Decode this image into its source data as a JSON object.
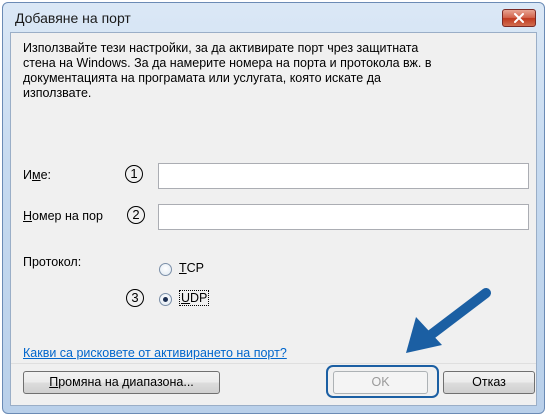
{
  "window": {
    "title": "Добавяне на порт"
  },
  "description": "Използвайте тези настройки, за да активирате порт чрез защитната\nстена на Windows. За да намерите номера на порта и протокола вж. в\nдокументацията на програмата или услугата, която искате да\nизползвате.",
  "fields": {
    "name": {
      "label_pre": "И",
      "label_ul": "м",
      "label_post": "е:",
      "value": ""
    },
    "port": {
      "label_ul": "Н",
      "label_post": "омер на пор",
      "value": ""
    }
  },
  "protocol": {
    "label": "Протокол:",
    "tcp_ul": "T",
    "tcp_rest": "CP",
    "udp_ul": "U",
    "udp_rest": "DP",
    "selected": "UDP"
  },
  "markers": {
    "m1": "1",
    "m2": "2",
    "m3": "3"
  },
  "link": "Какви са рисковете от активирането на порт?",
  "buttons": {
    "change_scope_ul": "П",
    "change_scope_rest": "ромяна на диапазона...",
    "ok": "OK",
    "cancel": "Отказ"
  },
  "colors": {
    "highlight": "#1b5fa3",
    "link": "#0066cc"
  }
}
